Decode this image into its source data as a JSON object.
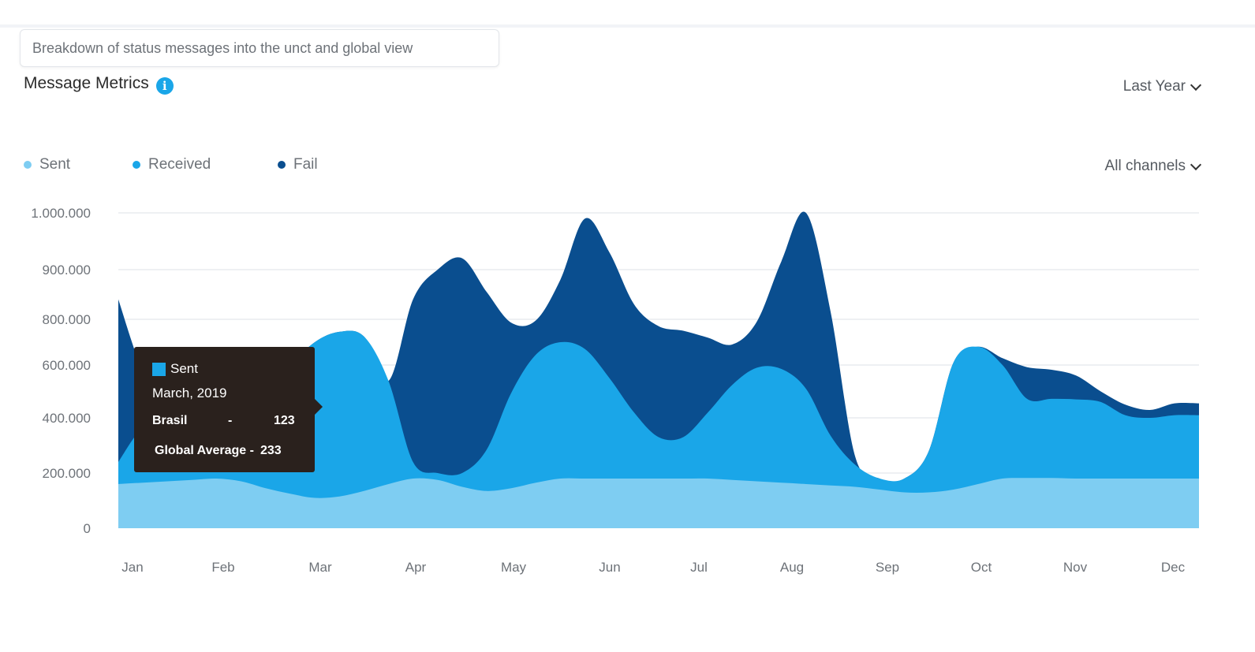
{
  "header": {
    "description": "Breakdown of status messages into the unct and global view",
    "title": "Message Metrics",
    "info_glyph": "i",
    "period_label": "Last Year",
    "channel_label": "All channels"
  },
  "colors": {
    "sent": "#7ecdf2",
    "received": "#1aa6e8",
    "fail": "#0a4e8f",
    "tooltip_bg": "#2a211d"
  },
  "tooltip": {
    "series": "Sent",
    "date": "March, 2019",
    "row1_label": "Brasil",
    "row1_sep": "-",
    "row1_value": "123",
    "row2_label": "Global Average -",
    "row2_value": "233"
  },
  "chart_data": {
    "type": "area",
    "stacked": true,
    "categories": [
      "Jan",
      "Feb",
      "Mar",
      "Apr",
      "May",
      "Jun",
      "Jul",
      "Aug",
      "Sep",
      "Oct",
      "Nov",
      "Dec"
    ],
    "y_ticks": [
      "0",
      "200.000",
      "400.000",
      "600.000",
      "800.000",
      "900.000",
      "1.000.000"
    ],
    "y_tick_values": [
      0,
      200000,
      400000,
      600000,
      800000,
      900000,
      1000000
    ],
    "x": [
      0,
      0.25,
      0.5,
      0.75,
      1,
      1.25,
      1.5,
      1.75,
      2,
      2.25,
      2.5,
      2.75,
      3,
      3.25,
      3.5,
      3.75,
      4,
      4.25,
      4.5,
      4.75,
      5,
      5.25,
      5.5,
      5.75,
      6,
      6.25,
      6.5,
      6.75,
      7,
      7.25,
      7.5,
      7.75,
      8,
      8.25,
      8.5,
      8.75,
      9,
      9.25,
      9.5,
      9.75,
      10,
      10.25,
      10.5,
      10.75,
      11
    ],
    "series": [
      {
        "name": "Sent",
        "values": [
          160000,
          165000,
          170000,
          175000,
          180000,
          170000,
          145000,
          125000,
          110000,
          115000,
          135000,
          160000,
          180000,
          175000,
          150000,
          135000,
          145000,
          165000,
          180000,
          180000,
          180000,
          180000,
          180000,
          180000,
          180000,
          175000,
          170000,
          165000,
          160000,
          155000,
          150000,
          140000,
          130000,
          130000,
          140000,
          160000,
          180000,
          182000,
          182000,
          180000,
          180000,
          180000,
          180000,
          180000,
          180000
        ]
      },
      {
        "name": "Received",
        "values": [
          80000,
          200000,
          210000,
          50000,
          40000,
          100000,
          290000,
          470000,
          590000,
          630000,
          590000,
          380000,
          60000,
          25000,
          50000,
          150000,
          350000,
          480000,
          520000,
          490000,
          370000,
          240000,
          150000,
          150000,
          240000,
          350000,
          420000,
          420000,
          350000,
          180000,
          80000,
          40000,
          50000,
          150000,
          470000,
          520000,
          420000,
          290000,
          290000,
          290000,
          280000,
          230000,
          220000,
          230000,
          230000
        ]
      },
      {
        "name": "Fail",
        "values": [
          600000,
          210000,
          60000,
          75000,
          190000,
          120000,
          50000,
          0,
          0,
          0,
          0,
          0,
          600000,
          700000,
          720000,
          570000,
          290000,
          150000,
          180000,
          320000,
          380000,
          410000,
          440000,
          420000,
          300000,
          165000,
          200000,
          330000,
          490000,
          480000,
          30000,
          0,
          0,
          0,
          0,
          0,
          30000,
          120000,
          110000,
          90000,
          40000,
          40000,
          30000,
          45000,
          45000
        ]
      }
    ],
    "xlabel": "",
    "ylabel": "",
    "grid": true,
    "legend": "top-left"
  }
}
